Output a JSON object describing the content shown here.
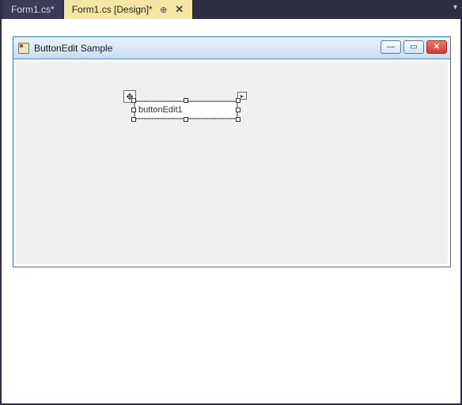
{
  "tabs": {
    "inactive": {
      "label": "Form1.cs*"
    },
    "active": {
      "label": "Form1.cs [Design]*"
    }
  },
  "form": {
    "title": "ButtonEdit Sample",
    "control": {
      "text": "buttonEdit1"
    },
    "buttons": {
      "minimize": "—",
      "maximize": "▭",
      "close": "✕"
    }
  },
  "glyphs": {
    "move": "✥",
    "smarttag": "▸",
    "pin": "⊕",
    "tabclose": "✕",
    "dropdown": "▾"
  }
}
